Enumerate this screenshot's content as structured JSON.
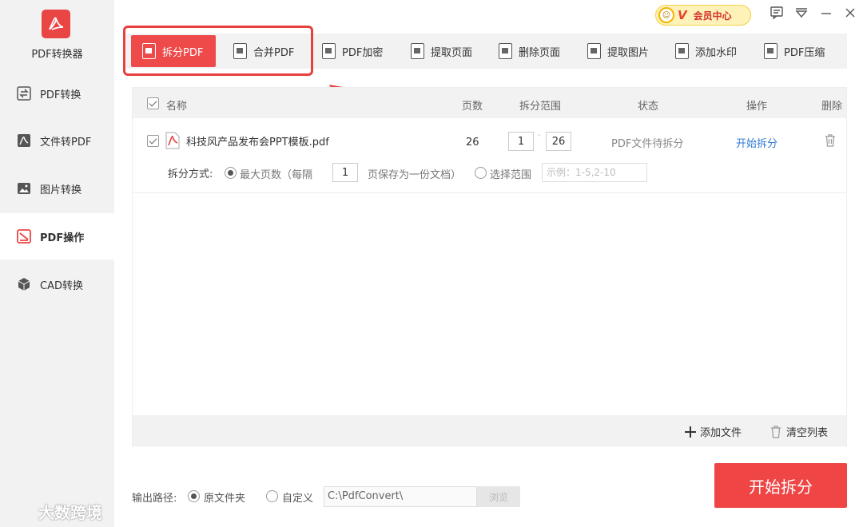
{
  "app": {
    "name": "PDF转换器",
    "logo_text": "PDF"
  },
  "sidebar": {
    "items": [
      {
        "label": "PDF转换",
        "icon": "swap-icon"
      },
      {
        "label": "文件转PDF",
        "icon": "pdf-file-icon"
      },
      {
        "label": "图片转换",
        "icon": "image-icon"
      },
      {
        "label": "PDF操作",
        "icon": "pdf-edit-icon",
        "active": true
      },
      {
        "label": "CAD转换",
        "icon": "cube-icon"
      }
    ]
  },
  "topbar": {
    "vip_face": "☺",
    "vip_letter": "V",
    "vip_label": "会员中心"
  },
  "toolbar": {
    "tools": [
      {
        "label": "拆分PDF",
        "active": true
      },
      {
        "label": "合并PDF"
      },
      {
        "label": "PDF加密"
      },
      {
        "label": "提取页面"
      },
      {
        "label": "删除页面"
      },
      {
        "label": "提取图片"
      },
      {
        "label": "添加水印"
      },
      {
        "label": "PDF压缩"
      }
    ]
  },
  "table": {
    "headers": {
      "name": "名称",
      "pages": "页数",
      "range": "拆分范围",
      "status": "状态",
      "action": "操作",
      "delete": "删除"
    },
    "rows": [
      {
        "filename": "科技风产品发布会PPT模板.pdf",
        "pages": "26",
        "range_from": "1",
        "range_sep": "-",
        "range_to": "26",
        "status": "PDF文件待拆分",
        "action": "开始拆分",
        "split_mode_label": "拆分方式:",
        "mode_max_label": "最大页数（每隔",
        "mode_max_value": "1",
        "mode_max_suffix": "页保存为一份文档）",
        "mode_range_label": "选择范围",
        "range_placeholder": "示例：1-5,2-10"
      }
    ],
    "footer": {
      "add_file": "添加文件",
      "clear_list": "清空列表"
    }
  },
  "output": {
    "label": "输出路径:",
    "option_original": "原文件夹",
    "option_custom": "自定义",
    "path": "C:\\PdfConvert\\",
    "browse": "浏览"
  },
  "start_button": "开始拆分",
  "watermark": "大数跨境",
  "colors": {
    "accent": "#ef4a4a",
    "link": "#2e7bd6",
    "highlight": "#e8403f"
  }
}
